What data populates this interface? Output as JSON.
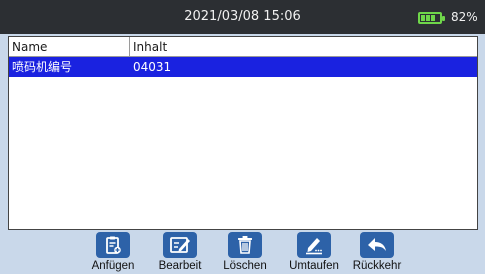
{
  "status": {
    "datetime": "2021/03/08 15:06",
    "battery_percent_text": "82%",
    "battery_level": 0.82
  },
  "table": {
    "columns": [
      "Name",
      "Inhalt"
    ],
    "rows": [
      {
        "name": "喷码机编号",
        "content": "04031",
        "selected": true
      }
    ]
  },
  "toolbar": {
    "buttons": [
      {
        "label": "Anfügen",
        "icon": "clipboard-add-icon"
      },
      {
        "label": "Bearbeit",
        "icon": "edit-note-icon"
      },
      {
        "label": "Löschen",
        "icon": "trash-icon"
      },
      {
        "label": "Umtaufen",
        "icon": "rename-pen-icon"
      },
      {
        "label": "Rückkehr",
        "icon": "return-arrow-icon"
      }
    ]
  },
  "colors": {
    "status_bg": "#2c2f33",
    "selection": "#1a22e0",
    "icon_bg": "#2d62a8",
    "battery": "#6fd64a",
    "footer_bg": "#c9d8ea"
  }
}
